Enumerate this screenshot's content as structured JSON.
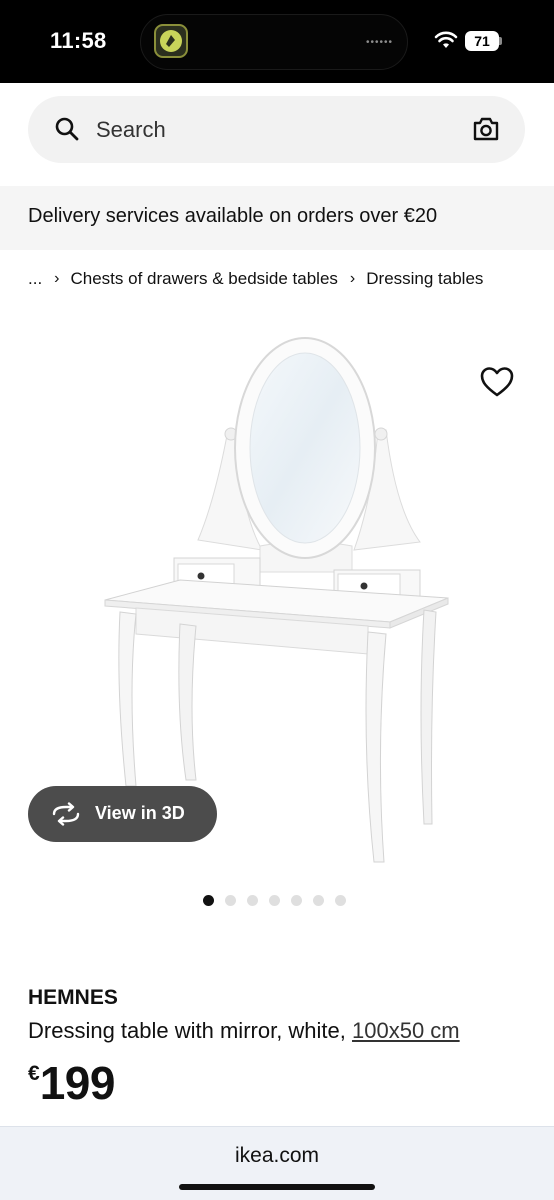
{
  "status_bar": {
    "time": "11:58",
    "battery": "71",
    "icons": [
      "wifi-icon",
      "battery-icon"
    ]
  },
  "search": {
    "placeholder": "Search",
    "icons": [
      "search-icon",
      "camera-icon"
    ]
  },
  "banner": {
    "text": "Delivery services available on orders over €20"
  },
  "breadcrumb": {
    "items": [
      "...",
      "Chests of drawers & bedside tables",
      "Dressing tables"
    ]
  },
  "product_image": {
    "favorite_icon": "heart-icon",
    "view3d_label": "View in 3D",
    "view3d_icon": "rotate-3d-icon",
    "carousel_count": 7,
    "carousel_active_index": 0
  },
  "product": {
    "name": "HEMNES",
    "description": "Dressing table with mirror, white,",
    "size": "100x50 cm",
    "currency": "€",
    "price": "199"
  },
  "browser": {
    "url": "ikea.com"
  },
  "colors": {
    "status_bar_bg": "#000000",
    "search_bg": "#f2f2f2",
    "banner_bg": "#f5f5f5",
    "view3d_bg": "#4c4c4c",
    "browser_bar_bg": "#eff2f7"
  }
}
